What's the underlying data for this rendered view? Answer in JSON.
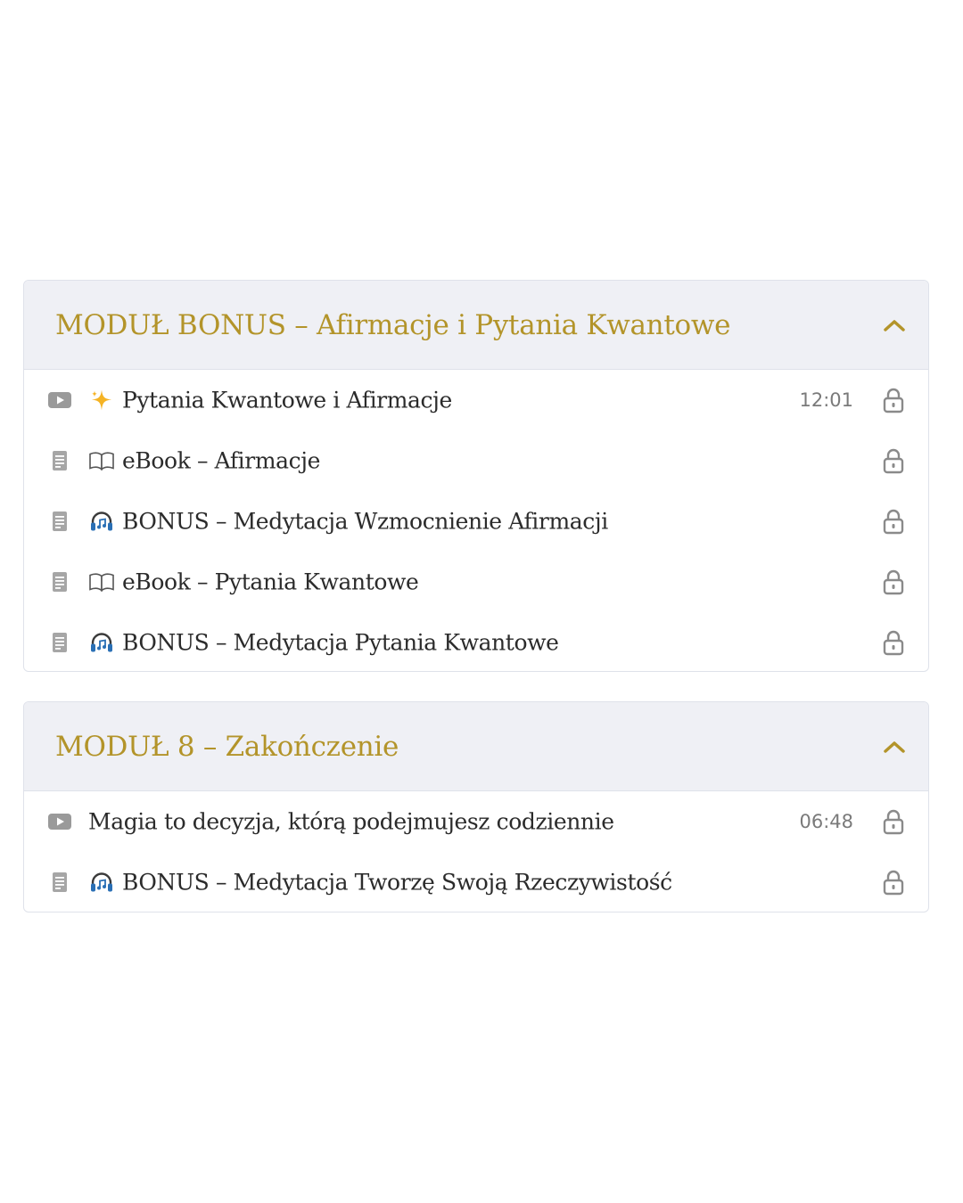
{
  "modules": [
    {
      "title": "MODUŁ BONUS – Afirmacje i Pytania Kwantowe",
      "lessons": [
        {
          "type": "video",
          "emoji": "sparkles",
          "title": "Pytania Kwantowe i Afirmacje",
          "duration": "12:01"
        },
        {
          "type": "document",
          "emoji": "book",
          "title": "eBook – Afirmacje",
          "duration": ""
        },
        {
          "type": "document",
          "emoji": "headphones",
          "title": "BONUS – Medytacja Wzmocnienie Afirmacji",
          "duration": ""
        },
        {
          "type": "document",
          "emoji": "book",
          "title": "eBook – Pytania Kwantowe",
          "duration": ""
        },
        {
          "type": "document",
          "emoji": "headphones",
          "title": "BONUS – Medytacja Pytania Kwantowe",
          "duration": ""
        }
      ]
    },
    {
      "title": "MODUŁ 8 – Zakończenie",
      "lessons": [
        {
          "type": "video",
          "emoji": "",
          "title": "Magia to decyzja, którą podejmujesz codziennie",
          "duration": "06:48"
        },
        {
          "type": "document",
          "emoji": "headphones",
          "title": "BONUS – Medytacja Tworzę Swoją Rzeczywistość",
          "duration": ""
        }
      ]
    }
  ],
  "icons": {
    "video": "play-icon",
    "document": "document-icon",
    "lock": "lock-icon",
    "chevron": "chevron-up-icon"
  },
  "colors": {
    "accent_gold": "#b3942a",
    "header_bg": "#eff0f5",
    "border": "#dfe2ea",
    "text": "#2b2b2b",
    "muted": "#7a7a7a",
    "icon_gray": "#9a9a9a"
  }
}
